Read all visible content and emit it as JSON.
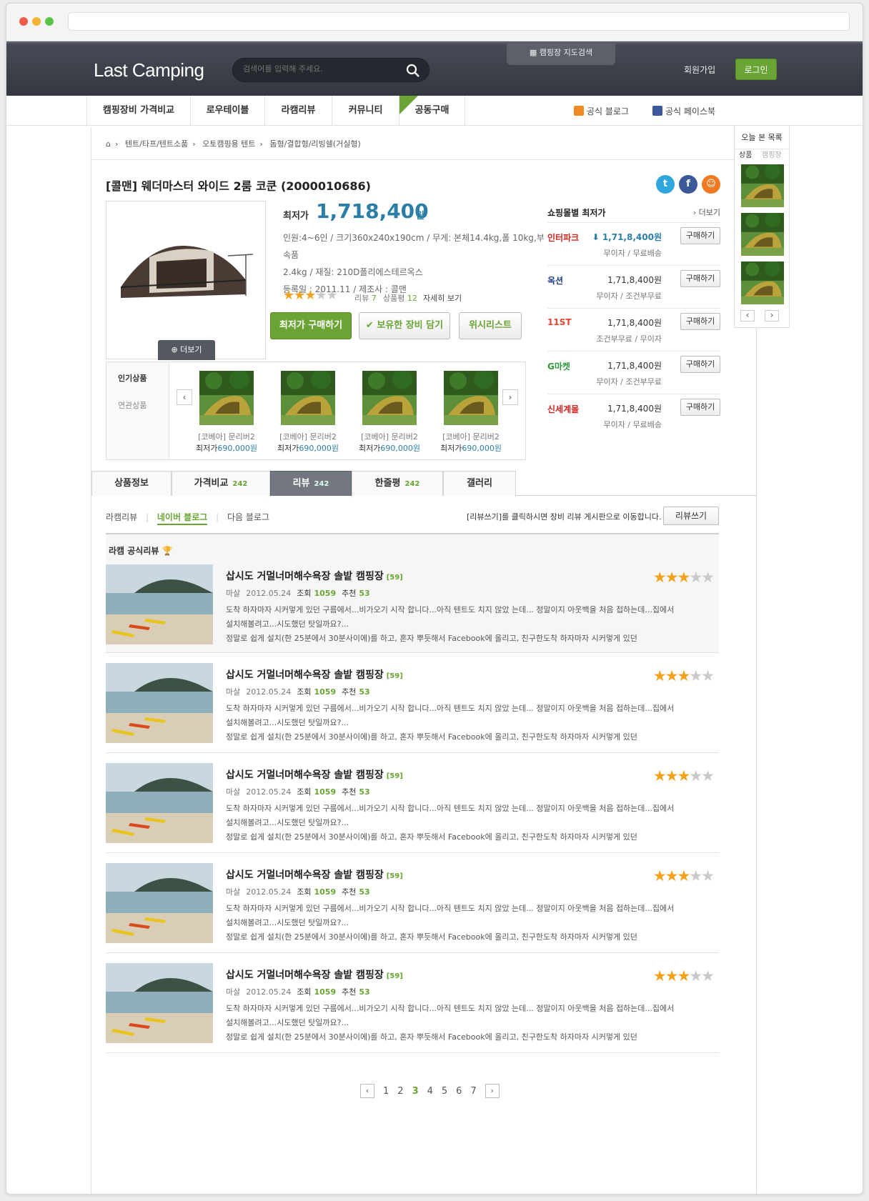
{
  "browser": {
    "url": ""
  },
  "header": {
    "logo": "Last Camping",
    "search_placeholder": "검색어를 입력해 주세요.",
    "map_search": "캠핑장 지도검색",
    "join": "회원가입",
    "login": "로그인"
  },
  "nav": {
    "items": [
      "캠핑장비 가격비교",
      "로우테이블",
      "라캠리뷰",
      "커뮤니티",
      "공동구매"
    ],
    "new_badge": "NEW",
    "blog": "공식 블로그",
    "facebook": "공식 페이스북"
  },
  "breadcrumb": [
    "텐트/타프/텐트소품",
    "오토캠핑용 텐트",
    "돔형/결합형/리빙쉘(거실형)"
  ],
  "product": {
    "title": "[콜맨] 웨더마스터 와이드 2룸 코쿤 (2000010686)",
    "lowest_label": "최저가",
    "price": "1,718,400",
    "currency": "원",
    "spec_line1": "인원:4~6인 / 크기360x240x190cm / 무게: 본체14.4kg,폴 10kg,부속품",
    "spec_line2": "2.4kg / 재질: 210D폴리에스테르옥스",
    "spec_line3": "등록일 : 2011.11 / 제조사 : 콜맨",
    "rating": 3,
    "review_label": "리뷰",
    "review_count": "7",
    "comment_label": "상품평",
    "comment_count": "12",
    "detail_link": "자세히 보기",
    "more_button": "더보기",
    "buttons": {
      "buy_lowest": "최저가 구매하기",
      "own": "보유한 장비 담기",
      "wishlist": "위시리스트"
    }
  },
  "shops": {
    "title": "쇼핑몰별 최저가",
    "more": "더보기",
    "buy_label": "구매하기",
    "rows": [
      {
        "name": "인터파크",
        "price": "1,71,8,400원",
        "ship": "무이자 / 무료배송",
        "color": "#d1261e"
      },
      {
        "name": "옥션",
        "price": "1,71,8,400원",
        "ship": "무이자 / 조건부무료",
        "color": "#1f3d8a"
      },
      {
        "name": "11ST",
        "price": "1,71,8,400원",
        "ship": "조건부무료 / 무이자",
        "color": "#e8442c"
      },
      {
        "name": "G마켓",
        "price": "1,71,8,400원",
        "ship": "무이자 / 조건부무료",
        "color": "#2d9a3a"
      },
      {
        "name": "신세계몰",
        "price": "1,71,8,400원",
        "ship": "무이자 / 무료배송",
        "color": "#d1261e"
      }
    ]
  },
  "related": {
    "tabs": [
      "인기상품",
      "연관상품"
    ],
    "lowest_label": "최저가",
    "items": [
      {
        "name": "[코베아] 문리버2",
        "price": "690,000원"
      },
      {
        "name": "[코베아] 문리버2",
        "price": "690,000원"
      },
      {
        "name": "[코베아] 문리버2",
        "price": "690,000원"
      },
      {
        "name": "[코베아] 문리버2",
        "price": "690,000원"
      }
    ]
  },
  "tabs": [
    {
      "label": "상품정보",
      "count": ""
    },
    {
      "label": "가격비교",
      "count": "242"
    },
    {
      "label": "리뷰",
      "count": "242"
    },
    {
      "label": "한줄평",
      "count": "242"
    },
    {
      "label": "갤러리",
      "count": ""
    }
  ],
  "review_section": {
    "subtabs": [
      "라캠리뷰",
      "네이버 블로그",
      "다음 블로그"
    ],
    "notice": "[리뷰쓰기]를 클릭하시면 장비 리뷰 게시판으로 이동합니다.",
    "write_button": "리뷰쓰기",
    "official_title": "라캠 공식리뷰"
  },
  "reviews": [
    {
      "title": "삽시도 거멀너머해수욕장 솔밭 캠핑장",
      "comments": "[59]",
      "author": "마살",
      "date": "2012.05.24",
      "views_label": "조회",
      "views": "1059",
      "rec_label": "추천",
      "rec": "53",
      "rating": 3,
      "line1": "도착 하자마자 시커멓게 있던 구름에서...비가오기 시작 합니다...아직 텐트도 치지 않았 는데... 정말이지 아웃백을 처음 접하는데...집에서",
      "line2": "설치해볼려고...시도했던 탓일까요?...",
      "line3": "정말로 쉽게 설치(한 25분에서 30분사이에)를 하고, 혼자 뿌듯해서 Facebook에 올리고, 친구한도착 하자마자 시커멓게 있던"
    },
    {
      "title": "삽시도 거멀너머해수욕장 솔밭 캠핑장",
      "comments": "[59]",
      "author": "마살",
      "date": "2012.05.24",
      "views_label": "조회",
      "views": "1059",
      "rec_label": "추천",
      "rec": "53",
      "rating": 3,
      "line1": "도착 하자마자 시커멓게 있던 구름에서...비가오기 시작 합니다...아직 텐트도 치지 않았 는데... 정말이지 아웃백을 처음 접하는데...집에서",
      "line2": "설치해볼려고...시도했던 탓일까요?...",
      "line3": "정말로 쉽게 설치(한 25분에서 30분사이에)를 하고, 혼자 뿌듯해서 Facebook에 올리고, 친구한도착 하자마자 시커멓게 있던"
    },
    {
      "title": "삽시도 거멀너머해수욕장 솔밭 캠핑장",
      "comments": "[59]",
      "author": "마살",
      "date": "2012.05.24",
      "views_label": "조회",
      "views": "1059",
      "rec_label": "추천",
      "rec": "53",
      "rating": 3,
      "line1": "도착 하자마자 시커멓게 있던 구름에서...비가오기 시작 합니다...아직 텐트도 치지 않았 는데... 정말이지 아웃백을 처음 접하는데...집에서",
      "line2": "설치해볼려고...시도했던 탓일까요?...",
      "line3": "정말로 쉽게 설치(한 25분에서 30분사이에)를 하고, 혼자 뿌듯해서 Facebook에 올리고, 친구한도착 하자마자 시커멓게 있던"
    },
    {
      "title": "삽시도 거멀너머해수욕장 솔밭 캠핑장",
      "comments": "[59]",
      "author": "마살",
      "date": "2012.05.24",
      "views_label": "조회",
      "views": "1059",
      "rec_label": "추천",
      "rec": "53",
      "rating": 3,
      "line1": "도착 하자마자 시커멓게 있던 구름에서...비가오기 시작 합니다...아직 텐트도 치지 않았 는데... 정말이지 아웃백을 처음 접하는데...집에서",
      "line2": "설치해볼려고...시도했던 탓일까요?...",
      "line3": "정말로 쉽게 설치(한 25분에서 30분사이에)를 하고, 혼자 뿌듯해서 Facebook에 올리고, 친구한도착 하자마자 시커멓게 있던"
    },
    {
      "title": "삽시도 거멀너머해수욕장 솔밭 캠핑장",
      "comments": "[59]",
      "author": "마살",
      "date": "2012.05.24",
      "views_label": "조회",
      "views": "1059",
      "rec_label": "추천",
      "rec": "53",
      "rating": 3,
      "line1": "도착 하자마자 시커멓게 있던 구름에서...비가오기 시작 합니다...아직 텐트도 치지 않았 는데... 정말이지 아웃백을 처음 접하는데...집에서",
      "line2": "설치해볼려고...시도했던 탓일까요?...",
      "line3": "정말로 쉽게 설치(한 25분에서 30분사이에)를 하고, 혼자 뿌듯해서 Facebook에 올리고, 친구한도착 하자마자 시커멓게 있던"
    }
  ],
  "pagination": {
    "pages": [
      "1",
      "2",
      "3",
      "4",
      "5",
      "6",
      "7"
    ],
    "current": "3"
  },
  "recent": {
    "title": "오늘 본 목록",
    "tabs": [
      "상품",
      "캠핑장"
    ]
  },
  "colors": {
    "accent": "#6aa434",
    "price": "#2b7fa7",
    "header": "#3a3e49"
  }
}
